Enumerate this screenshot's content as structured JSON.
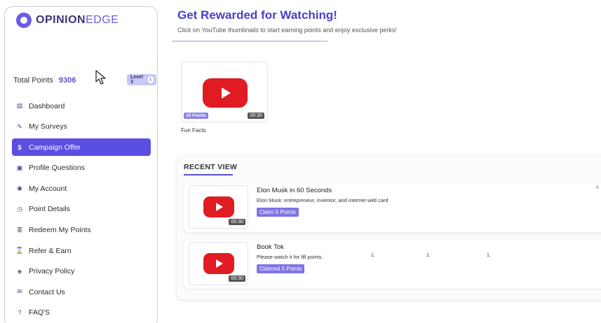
{
  "brand": {
    "bold": "OPINION",
    "light": "EDGE"
  },
  "account": {
    "points_label": "Total Points",
    "points_value": "9306",
    "level": "Level 3",
    "info_glyph": "i"
  },
  "menu": [
    {
      "label": "Dashboard",
      "icon": "dashboard-icon",
      "glyph": "▤"
    },
    {
      "label": "My Surveys",
      "icon": "clipboard-icon",
      "glyph": "✎"
    },
    {
      "label": "Campaign Offer",
      "icon": "dollar-icon",
      "glyph": "$"
    },
    {
      "label": "Profile Questions",
      "icon": "user-questions-icon",
      "glyph": "▣"
    },
    {
      "label": "My Account",
      "icon": "account-icon",
      "glyph": "◉"
    },
    {
      "label": "Point Details",
      "icon": "clock-icon",
      "glyph": "◷"
    },
    {
      "label": "Redeem My Points",
      "icon": "coins-icon",
      "glyph": "≣"
    },
    {
      "label": "Refer & Earn",
      "icon": "gift-icon",
      "glyph": "⌛"
    },
    {
      "label": "Privacy Policy",
      "icon": "shield-icon",
      "glyph": "◈"
    },
    {
      "label": "Contact Us",
      "icon": "envelope-icon",
      "glyph": "✉"
    },
    {
      "label": "FAQ'S",
      "icon": "question-icon",
      "glyph": "?"
    }
  ],
  "main": {
    "title": "Get Rewarded for Watching!",
    "subtitle": "Click on YouTube thumbnails to start earning points and enjoy exclusive perks!"
  },
  "featured_video": {
    "points": "10 Points",
    "duration": "00:30",
    "title": "Fun Facts"
  },
  "recent": {
    "heading": "RECENT VIEW",
    "items": [
      {
        "title": "Elon Musk in 60 Seconds",
        "description": "Elon Musk: entrepreneur, inventor, and internet wild card",
        "button": "Claim 5 Points",
        "duration": "00:30",
        "corner": "A"
      },
      {
        "title": "Book Tok",
        "description": "Please watch it for fill points.",
        "button": "Claimed 5 Points",
        "duration": "00:30",
        "dots": [
          "1.",
          "1.",
          "1."
        ]
      }
    ]
  },
  "colors": {
    "accent": "#5b4fe3",
    "title": "#4a3fc9",
    "youtube": "#e11b22",
    "badge": "#7e74e6"
  }
}
